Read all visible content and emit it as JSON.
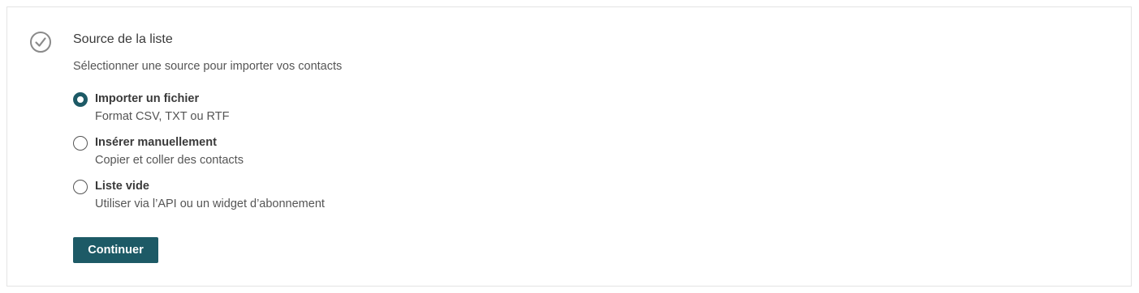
{
  "step": {
    "icon": "check-circle-icon",
    "title": "Source de la liste",
    "subtitle": "Sélectionner une source pour importer vos contacts"
  },
  "options": [
    {
      "label": "Importer un fichier",
      "description": "Format CSV, TXT ou RTF",
      "selected": true
    },
    {
      "label": "Insérer manuellement",
      "description": "Copier et coller des contacts",
      "selected": false
    },
    {
      "label": "Liste vide",
      "description": "Utiliser via l’API ou un widget d’abonnement",
      "selected": false
    }
  ],
  "actions": {
    "continue_label": "Continuer"
  },
  "colors": {
    "accent": "#1d5a66",
    "text": "#3a3a3a",
    "muted": "#555555",
    "border": "#e4e4e4",
    "icon": "#8a8a8a"
  }
}
